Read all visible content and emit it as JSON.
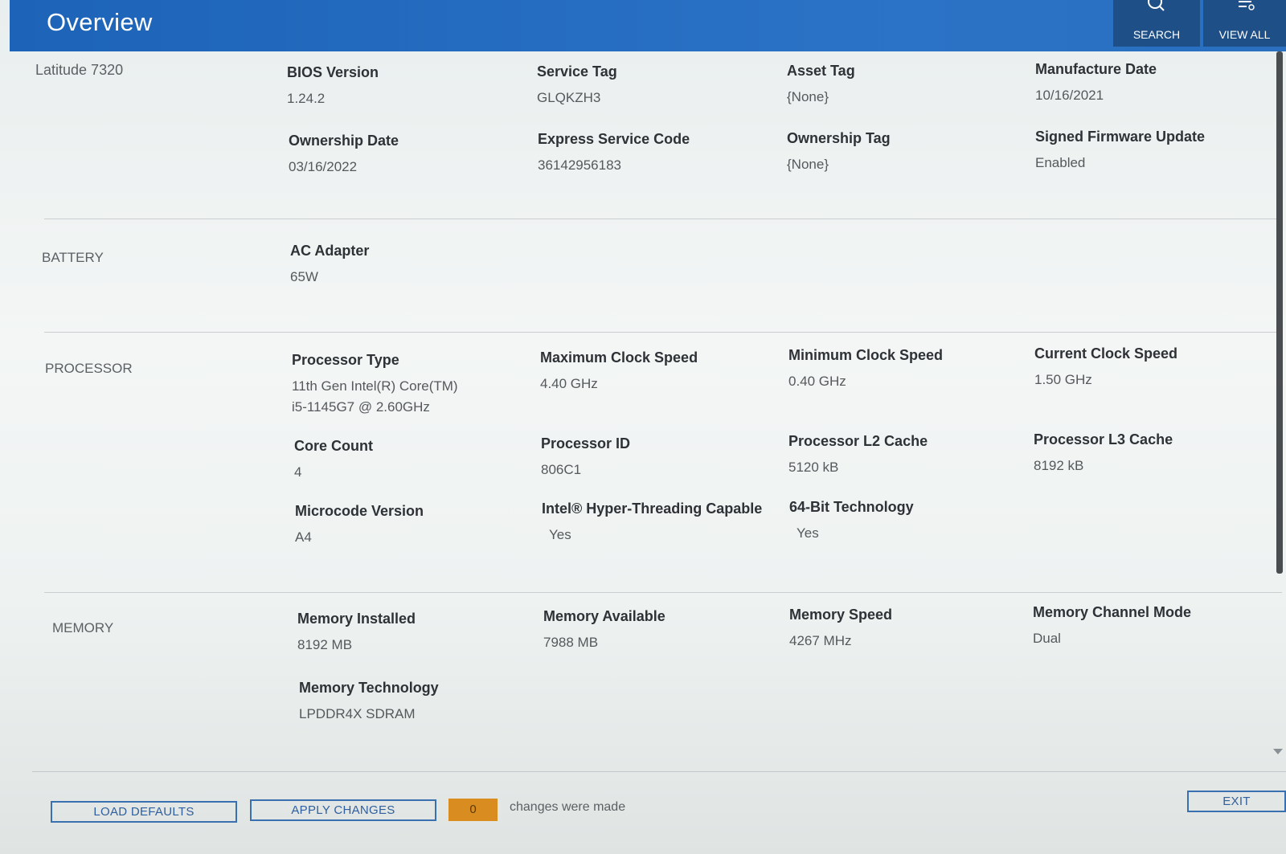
{
  "header": {
    "title": "Overview",
    "search_label": "SEARCH",
    "viewall_label": "VIEW ALL"
  },
  "model": "Latitude 7320",
  "system": {
    "bios_version": {
      "label": "BIOS Version",
      "value": "1.24.2"
    },
    "service_tag": {
      "label": "Service Tag",
      "value": "GLQKZH3"
    },
    "asset_tag": {
      "label": "Asset Tag",
      "value": "{None}"
    },
    "manufacture_date": {
      "label": "Manufacture Date",
      "value": "10/16/2021"
    },
    "ownership_date": {
      "label": "Ownership Date",
      "value": "03/16/2022"
    },
    "express_service_code": {
      "label": "Express Service Code",
      "value": "36142956183"
    },
    "ownership_tag": {
      "label": "Ownership Tag",
      "value": "{None}"
    },
    "signed_firmware_update": {
      "label": "Signed Firmware Update",
      "value": "Enabled"
    }
  },
  "battery": {
    "section": "BATTERY",
    "ac_adapter": {
      "label": "AC Adapter",
      "value": "65W"
    }
  },
  "processor": {
    "section": "PROCESSOR",
    "type": {
      "label": "Processor Type",
      "value_line1": "11th Gen Intel(R) Core(TM)",
      "value_line2": "i5-1145G7 @ 2.60GHz"
    },
    "max_clock": {
      "label": "Maximum Clock Speed",
      "value": "4.40 GHz"
    },
    "min_clock": {
      "label": "Minimum Clock Speed",
      "value": "0.40 GHz"
    },
    "current_clock": {
      "label": "Current Clock Speed",
      "value": "1.50 GHz"
    },
    "core_count": {
      "label": "Core Count",
      "value": "4"
    },
    "processor_id": {
      "label": "Processor ID",
      "value": "806C1"
    },
    "l2_cache": {
      "label": "Processor L2 Cache",
      "value": "5120 kB"
    },
    "l3_cache": {
      "label": "Processor L3 Cache",
      "value": "8192 kB"
    },
    "microcode": {
      "label": "Microcode Version",
      "value": "A4"
    },
    "hyperthreading": {
      "label": "Intel® Hyper-Threading Capable",
      "value": "Yes"
    },
    "bit64": {
      "label": "64-Bit Technology",
      "value": "Yes"
    }
  },
  "memory": {
    "section": "MEMORY",
    "installed": {
      "label": "Memory Installed",
      "value": "8192 MB"
    },
    "available": {
      "label": "Memory Available",
      "value": "7988 MB"
    },
    "speed": {
      "label": "Memory Speed",
      "value": "4267 MHz"
    },
    "channel_mode": {
      "label": "Memory Channel Mode",
      "value": "Dual"
    },
    "technology": {
      "label": "Memory Technology",
      "value": "LPDDR4X SDRAM"
    }
  },
  "footer": {
    "load_defaults": "LOAD DEFAULTS",
    "apply_changes": "APPLY CHANGES",
    "changes_count": "0",
    "changes_text": "changes were made",
    "exit": "EXIT"
  },
  "colors": {
    "header_blue": "#2b73c6",
    "header_button": "#1e4f87",
    "counter_orange": "#d98c1f",
    "button_border": "#3a6fb0"
  },
  "icons": {
    "search": "magnifier-icon",
    "view_all": "list-settings-icon"
  }
}
